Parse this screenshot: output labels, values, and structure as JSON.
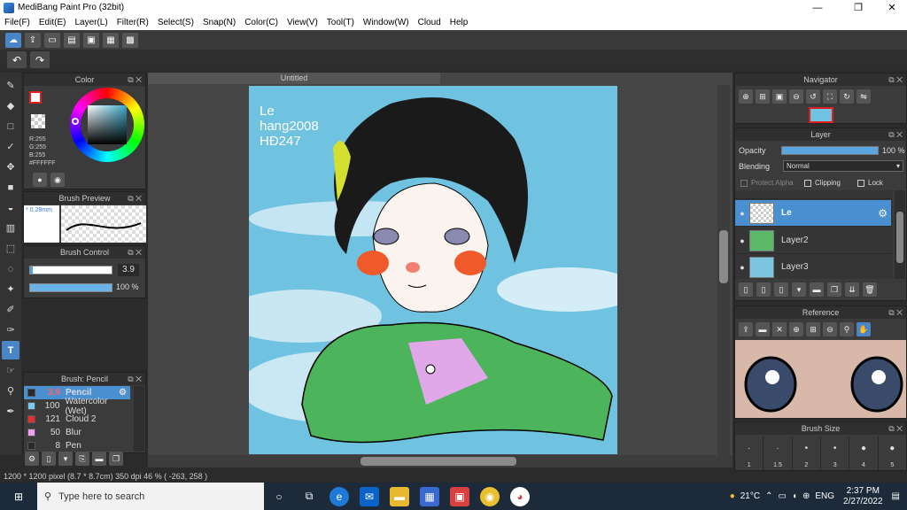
{
  "window": {
    "title": "MediBang Paint Pro (32bit)",
    "minimize": "—",
    "maximize": "❐",
    "close": "✕"
  },
  "menu": [
    "File(F)",
    "Edit(E)",
    "Layer(L)",
    "Filter(R)",
    "Select(S)",
    "Snap(N)",
    "Color(C)",
    "View(V)",
    "Tool(T)",
    "Window(W)",
    "Cloud",
    "Help"
  ],
  "color_panel": {
    "title": "Color",
    "r": "R:255",
    "g": "G:255",
    "b": "B:255",
    "hex": "#FFFFFF"
  },
  "brush_preview": {
    "title": "Brush Preview",
    "size": "0.28mm"
  },
  "brush_control": {
    "title": "Brush Control",
    "size_value": "3.9",
    "opacity_value": "100 %",
    "opacity_fraction": 1.0
  },
  "brush_list": {
    "title": "Brush: Pencil",
    "items": [
      {
        "size": "3.9",
        "name": "Pencil",
        "color": "#2a2a2a"
      },
      {
        "size": "100",
        "name": "Watercolor (Wet)",
        "color": "#7ec8f0"
      },
      {
        "size": "121",
        "name": "Cloud 2",
        "color": "#e03030"
      },
      {
        "size": "50",
        "name": "Blur",
        "color": "#f0a0f0"
      },
      {
        "size": "8",
        "name": "Pen",
        "color": "#2a2a2a"
      }
    ]
  },
  "document": {
    "tab": "Untitled",
    "canvas_text": "Le\nhang2008\nHĐ247"
  },
  "navigator": {
    "title": "Navigator"
  },
  "layer_panel": {
    "title": "Layer",
    "opacity_label": "Opacity",
    "opacity_value": "100 %",
    "opacity_fraction": 1.0,
    "blending_label": "Blending",
    "blending_value": "Normal",
    "protect_alpha": "Protect Alpha",
    "clipping": "Clipping",
    "lock": "Lock",
    "layers": [
      "Le",
      "Layer2",
      "Layer3"
    ]
  },
  "reference": {
    "title": "Reference"
  },
  "brush_size": {
    "title": "Brush Size",
    "values": [
      "1",
      "1.5",
      "2",
      "3",
      "4",
      "5"
    ]
  },
  "status": {
    "text": "1200 * 1200 pixel   (8.7 * 8.7cm)   350 dpi   46 %   ( -263, 258 )"
  },
  "taskbar": {
    "search_placeholder": "Type here to search",
    "weather": "21°C",
    "lang": "ENG",
    "time": "2:37 PM",
    "date": "2/27/2022"
  }
}
